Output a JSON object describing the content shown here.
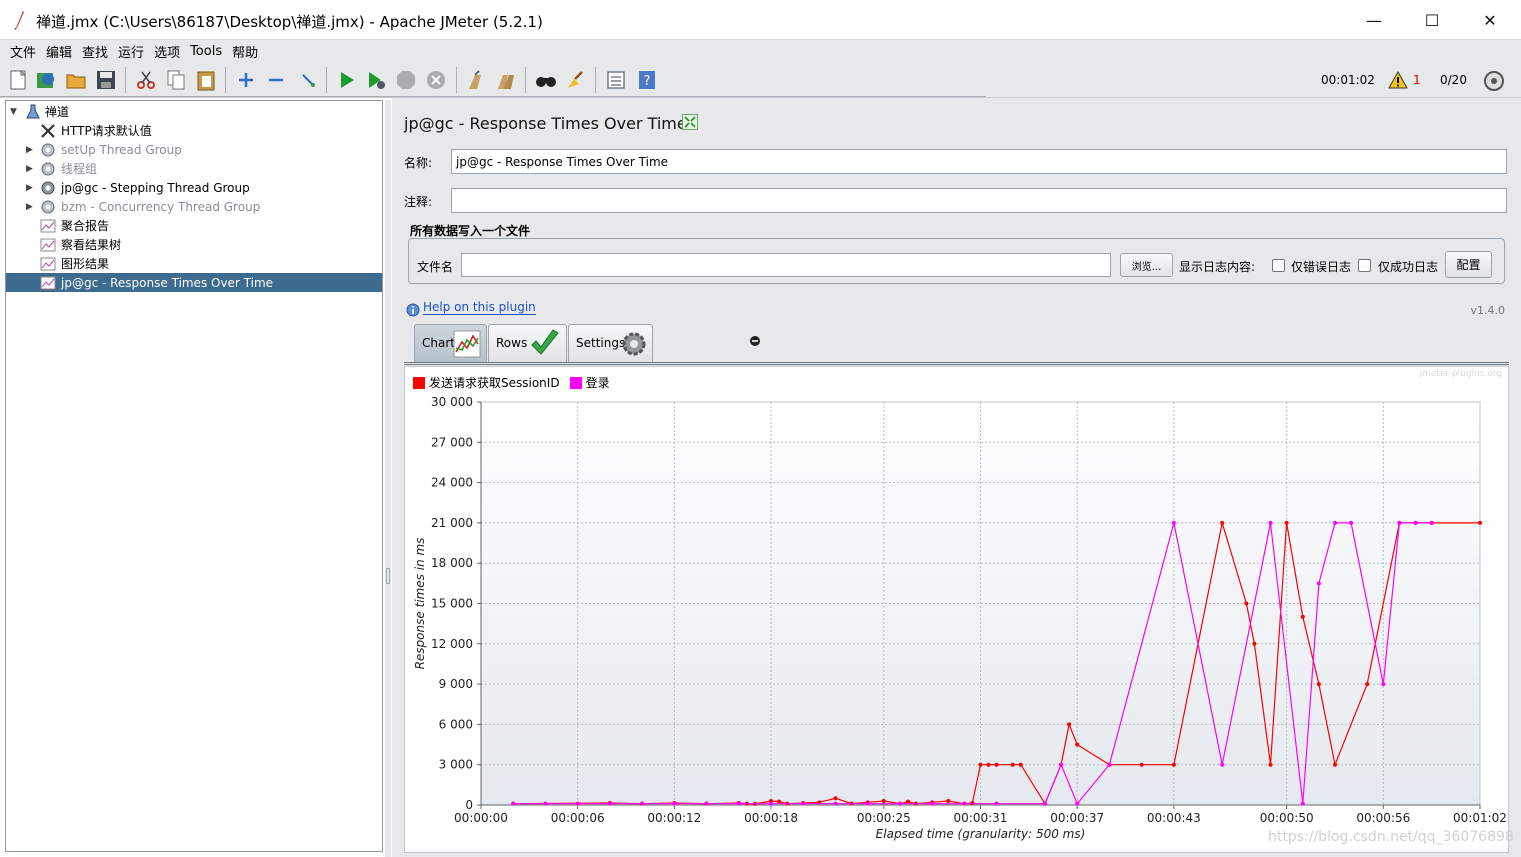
{
  "window": {
    "title": "禅道.jmx (C:\\Users\\86187\\Desktop\\禅道.jmx) - Apache JMeter (5.2.1)",
    "minimize": "—",
    "maximize": "☐",
    "close": "✕"
  },
  "menu": [
    "文件",
    "编辑",
    "查找",
    "运行",
    "选项",
    "Tools",
    "帮助"
  ],
  "toolbar": {
    "elapsed": "00:01:02",
    "warnings": "1",
    "threads": "0/20"
  },
  "tree": [
    {
      "label": "禅道",
      "icon": "test-plan-icon",
      "level": 0,
      "expanded": true
    },
    {
      "label": "HTTP请求默认值",
      "icon": "config-tools-icon",
      "level": 1
    },
    {
      "label": "setUp Thread Group",
      "icon": "gear-icon",
      "level": 1,
      "collapsed": true,
      "disabled": true
    },
    {
      "label": "线程组",
      "icon": "gear-icon",
      "level": 1,
      "collapsed": true,
      "disabled": true
    },
    {
      "label": "jp@gc - Stepping Thread Group",
      "icon": "gear-icon",
      "level": 1,
      "collapsed": true
    },
    {
      "label": "bzm - Concurrency Thread Group",
      "icon": "gear-icon",
      "level": 1,
      "collapsed": true,
      "disabled": true
    },
    {
      "label": "聚合报告",
      "icon": "listener-icon",
      "level": 1
    },
    {
      "label": "察看结果树",
      "icon": "listener-icon",
      "level": 1
    },
    {
      "label": "图形结果",
      "icon": "listener-icon",
      "level": 1
    },
    {
      "label": "jp@gc - Response Times Over Time",
      "icon": "listener-icon",
      "level": 1,
      "selected": true
    }
  ],
  "panel": {
    "title": "jp@gc - Response Times Over Time",
    "name_label": "名称:",
    "name_value": "jp@gc - Response Times Over Time",
    "comment_label": "注释:",
    "comment_value": "",
    "file_group_title": "所有数据写入一个文件",
    "filename_label": "文件名",
    "filename_value": "",
    "browse_button": "浏览...",
    "log_label": "显示日志内容:",
    "errors_only": "仅错误日志",
    "success_only": "仅成功日志",
    "config_button": "配置",
    "help_link": "Help on this plugin",
    "version": "v1.4.0",
    "tabs": [
      "Chart",
      "Rows",
      "Settings"
    ],
    "chart_watermark": "jmeter-plugins.org",
    "page_watermark": "https://blog.csdn.net/qq_36076898"
  },
  "chart_data": {
    "type": "line",
    "ylabel": "Response times in ms",
    "xlabel": "Elapsed time (granularity: 500 ms)",
    "ylim": [
      0,
      30000
    ],
    "xlim": [
      0,
      62
    ],
    "yticks": [
      0,
      3000,
      6000,
      9000,
      12000,
      15000,
      18000,
      21000,
      24000,
      27000,
      30000
    ],
    "ytick_labels": [
      "0",
      "3 000",
      "6 000",
      "9 000",
      "12 000",
      "15 000",
      "18 000",
      "21 000",
      "24 000",
      "27 000",
      "30 000"
    ],
    "xticks": [
      0,
      6,
      12,
      18,
      25,
      31,
      37,
      43,
      50,
      56,
      62
    ],
    "xtick_labels": [
      "00:00:00",
      "00:00:06",
      "00:00:12",
      "00:00:18",
      "00:00:25",
      "00:00:31",
      "00:00:37",
      "00:00:43",
      "00:00:50",
      "00:00:56",
      "00:01:02"
    ],
    "grid": true,
    "legend_position": "top-left",
    "series": [
      {
        "name": "发送请求获取SessionID",
        "color": "#ff0000",
        "x": [
          2,
          8,
          10,
          12,
          14,
          16,
          16.5,
          17,
          18,
          18.5,
          19,
          20,
          21,
          22,
          23,
          24,
          25,
          26,
          26.5,
          27,
          28,
          29,
          30,
          30.5,
          31,
          31.5,
          32,
          33,
          33.5,
          35,
          36,
          36.5,
          37,
          39,
          41,
          43,
          46,
          47.5,
          48,
          49,
          50,
          51,
          52,
          53,
          55,
          57,
          58,
          59,
          62
        ],
        "y": [
          100,
          150,
          100,
          150,
          100,
          150,
          100,
          80,
          300,
          250,
          100,
          150,
          200,
          500,
          100,
          200,
          300,
          100,
          250,
          100,
          200,
          300,
          100,
          150,
          3000,
          3000,
          3000,
          3000,
          3000,
          100,
          3000,
          6000,
          4500,
          3000,
          3000,
          3000,
          21000,
          15000,
          12000,
          3000,
          21000,
          14000,
          9000,
          3000,
          9000,
          21000,
          21000,
          21000,
          21000
        ]
      },
      {
        "name": "登录",
        "color": "#ff00ff",
        "x": [
          2,
          4,
          6,
          8,
          10,
          12,
          14,
          16,
          18,
          20,
          22,
          24,
          26,
          28,
          30,
          32,
          35,
          36,
          37,
          39,
          43,
          46,
          49,
          51,
          52,
          53,
          54,
          56,
          57,
          58,
          59
        ],
        "y": [
          100,
          100,
          100,
          100,
          100,
          100,
          100,
          100,
          100,
          100,
          100,
          100,
          100,
          100,
          100,
          100,
          100,
          3000,
          100,
          3000,
          21000,
          3000,
          21000,
          100,
          16500,
          21000,
          21000,
          9000,
          21000,
          21000,
          21000
        ]
      }
    ]
  }
}
